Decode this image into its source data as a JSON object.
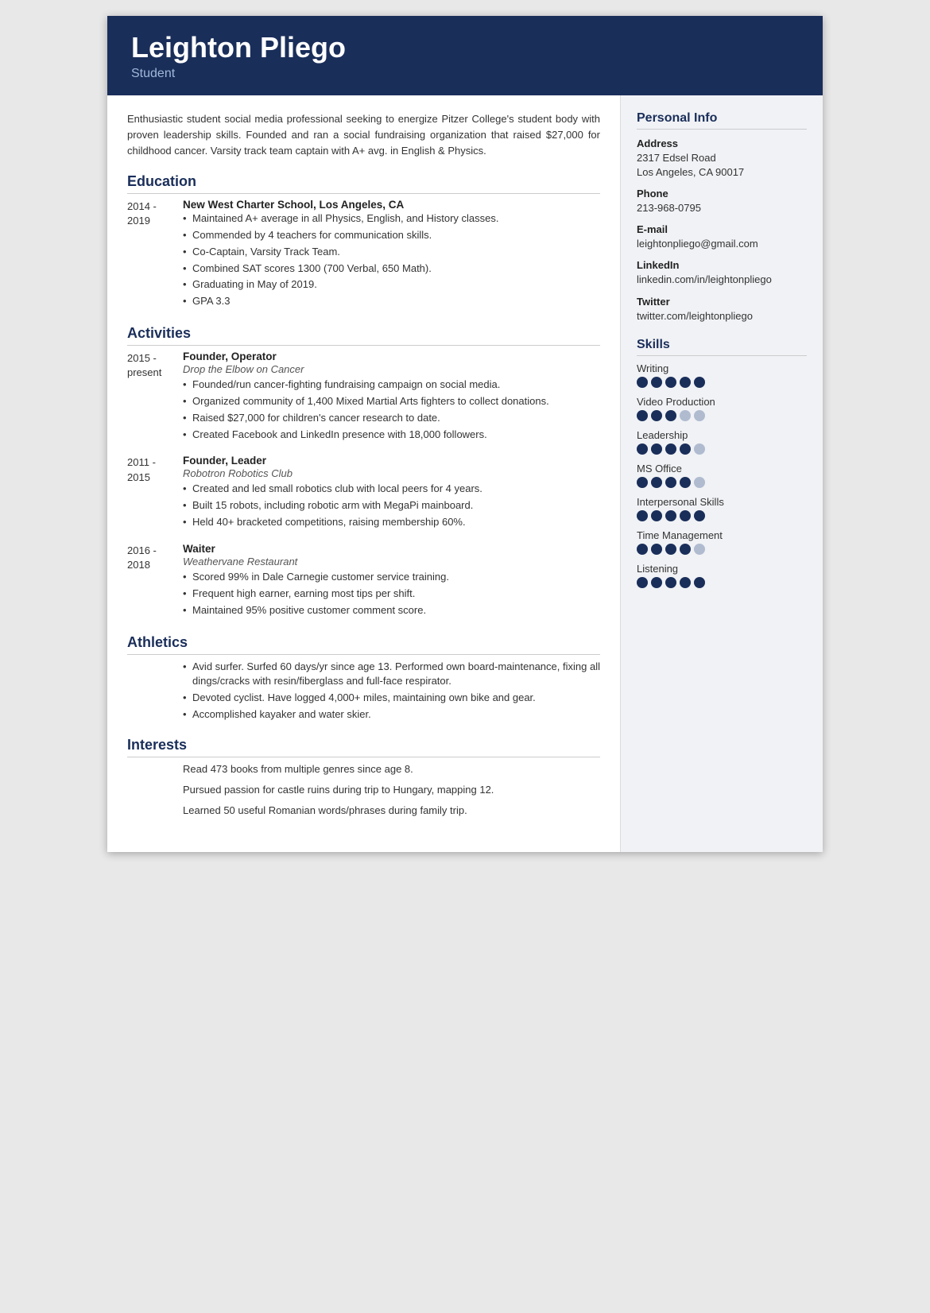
{
  "header": {
    "name": "Leighton Pliego",
    "title": "Student"
  },
  "summary": "Enthusiastic student social media professional seeking to energize Pitzer College's student body with proven leadership skills. Founded and ran a social fundraising organization that raised $27,000 for childhood cancer. Varsity track team captain with A+ avg. in English & Physics.",
  "sections": {
    "education_title": "Education",
    "activities_title": "Activities",
    "athletics_title": "Athletics",
    "interests_title": "Interests"
  },
  "education": [
    {
      "date": "2014 -\n2019",
      "org": "New West Charter School, Los Angeles, CA",
      "sub": "",
      "bullets": [
        "Maintained A+ average in all Physics, English, and History classes.",
        "Commended by 4 teachers for communication skills.",
        "Co-Captain, Varsity Track Team.",
        "Combined SAT scores 1300 (700 Verbal, 650 Math).",
        "Graduating in May of 2019.",
        "GPA 3.3"
      ]
    }
  ],
  "activities": [
    {
      "date": "2015 -\npresent",
      "org": "Founder, Operator",
      "sub": "Drop the Elbow on Cancer",
      "bullets": [
        "Founded/run cancer-fighting fundraising campaign on social media.",
        "Organized community of 1,400 Mixed Martial Arts fighters to collect donations.",
        "Raised $27,000 for children's cancer research to date.",
        "Created Facebook and LinkedIn presence with 18,000 followers."
      ]
    },
    {
      "date": "2011 -\n2015",
      "org": "Founder, Leader",
      "sub": "Robotron Robotics Club",
      "bullets": [
        "Created and led small robotics club with local peers for 4 years.",
        "Built 15 robots, including robotic arm with MegaPi mainboard.",
        "Held 40+ bracketed competitions, raising membership 60%."
      ]
    },
    {
      "date": "2016 -\n2018",
      "org": "Waiter",
      "sub": "Weathervane Restaurant",
      "bullets": [
        "Scored 99% in Dale Carnegie customer service training.",
        "Frequent high earner, earning most tips per shift.",
        "Maintained 95% positive customer comment score."
      ]
    }
  ],
  "athletics_bullets": [
    "Avid surfer. Surfed 60 days/yr since age 13. Performed own board-maintenance, fixing all dings/cracks with resin/fiberglass and full-face respirator.",
    "Devoted cyclist. Have logged 4,000+ miles, maintaining own bike and gear.",
    "Accomplished kayaker and water skier."
  ],
  "interests_items": [
    "Read 473 books from multiple genres since age 8.",
    "Pursued passion for castle ruins during trip to Hungary, mapping 12.",
    "Learned 50 useful Romanian words/phrases during family trip."
  ],
  "personal_info": {
    "title": "Personal Info",
    "address_label": "Address",
    "address_line1": "2317 Edsel Road",
    "address_line2": "Los Angeles, CA 90017",
    "phone_label": "Phone",
    "phone_value": "213-968-0795",
    "email_label": "E-mail",
    "email_value": "leightonpliego@gmail.com",
    "linkedin_label": "LinkedIn",
    "linkedin_value": "linkedin.com/in/leightonpliego",
    "twitter_label": "Twitter",
    "twitter_value": "twitter.com/leightonpliego"
  },
  "skills": {
    "title": "Skills",
    "items": [
      {
        "name": "Writing",
        "filled": 5,
        "total": 5
      },
      {
        "name": "Video Production",
        "filled": 3,
        "total": 5
      },
      {
        "name": "Leadership",
        "filled": 4,
        "total": 5
      },
      {
        "name": "MS Office",
        "filled": 4,
        "total": 5
      },
      {
        "name": "Interpersonal Skills",
        "filled": 5,
        "total": 5
      },
      {
        "name": "Time Management",
        "filled": 4,
        "total": 5
      },
      {
        "name": "Listening",
        "filled": 5,
        "total": 5
      }
    ]
  }
}
